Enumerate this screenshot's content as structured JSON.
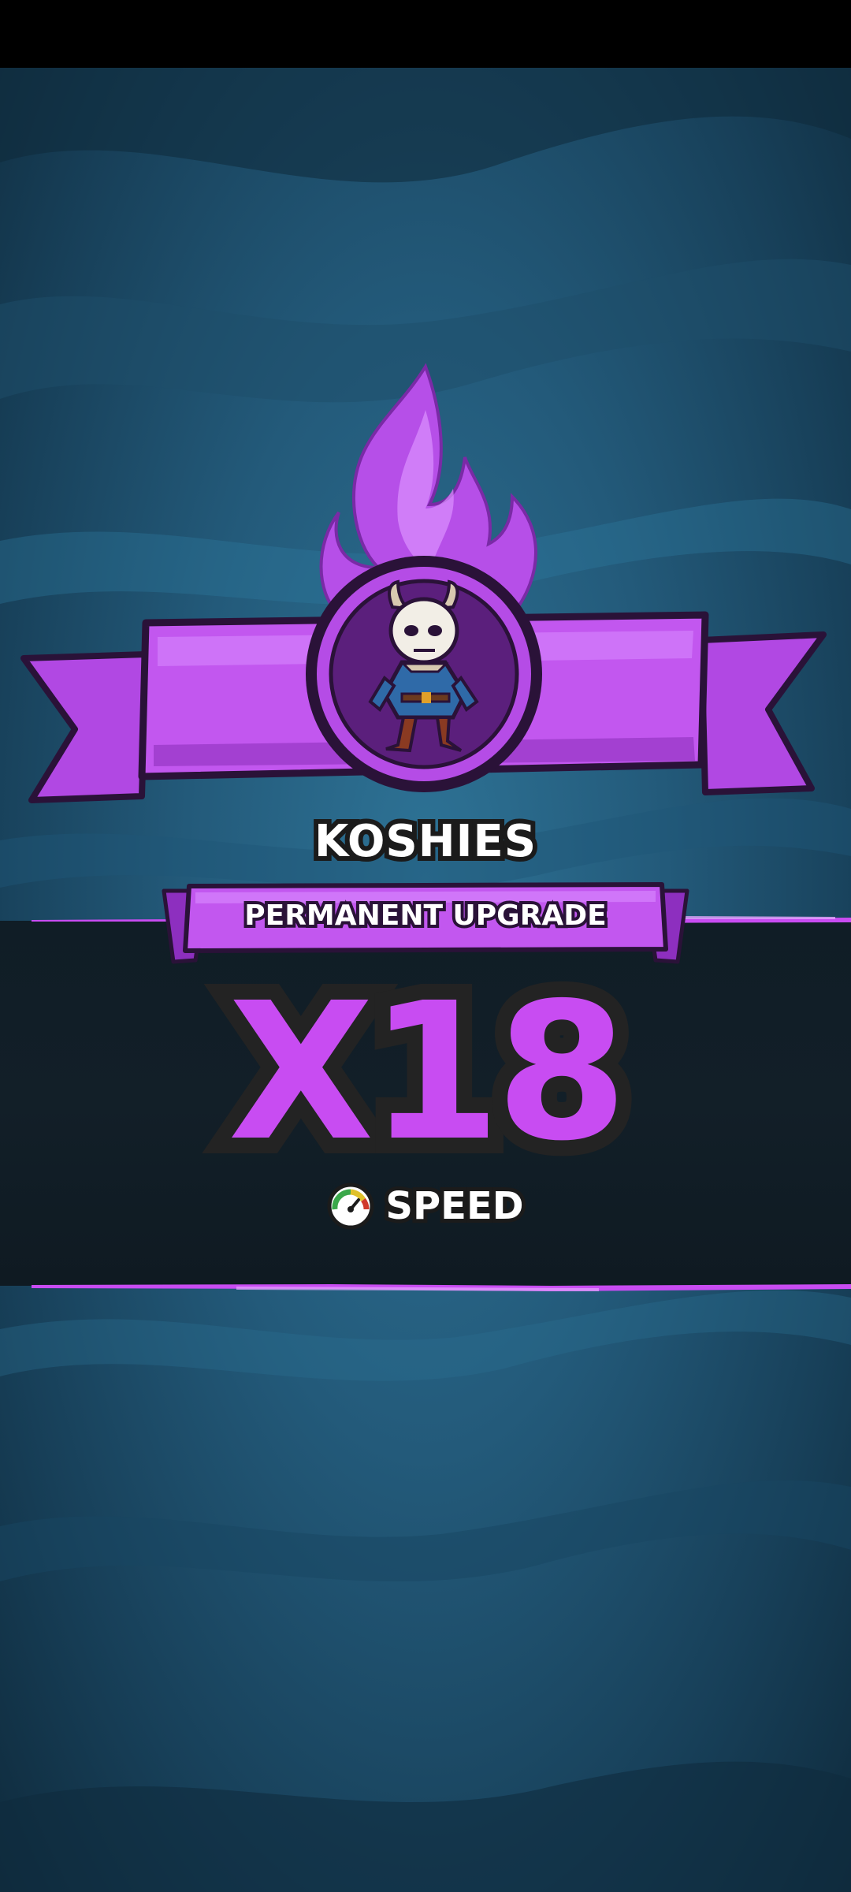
{
  "unit": {
    "name": "KOSHIES",
    "portrait_icon": "koshie-character-icon"
  },
  "upgrade": {
    "type_label": "PERMANENT UPGRADE",
    "multiplier": "X18",
    "stat_label": "SPEED",
    "stat_icon": "speedometer-icon"
  },
  "colors": {
    "accent_purple": "#c84cf2",
    "background_blue": "#235a7a",
    "band_dark": "#121f28"
  }
}
